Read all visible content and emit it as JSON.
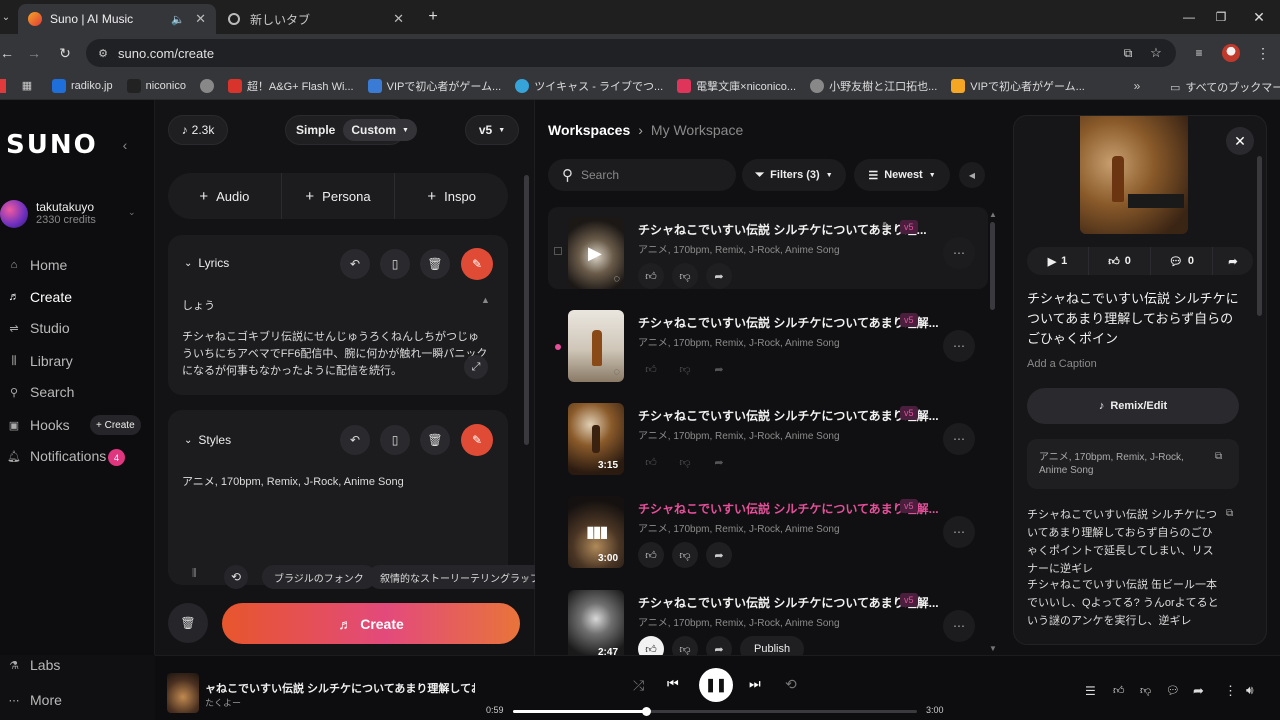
{
  "browser": {
    "tabs": [
      {
        "label": "Suno | AI Music",
        "active": true
      },
      {
        "label": "新しいタブ",
        "active": false
      }
    ],
    "url": "suno.com/create",
    "bookmarks": [
      "radiko.jp",
      "niconico",
      "超！A&G+ Flash Wi...",
      "VIPで初心者がゲーム...",
      "ツイキャス - ライブでつ...",
      "電撃文庫×niconico...",
      "小野友樹と江口拓也...",
      "VIPで初心者がゲーム..."
    ],
    "bookmark_colors": [
      "#1e6fd9",
      "#222222",
      "#888888",
      "#d9342b",
      "#3a7bd5",
      "#36a3d9",
      "#e0355a",
      "#888888",
      "#f5a623"
    ],
    "all_bookmarks": "すべてのブックマーク"
  },
  "sidebar": {
    "logo": "SUNO",
    "user": {
      "name": "takutakuyo",
      "credits": "2330 credits"
    },
    "items": [
      {
        "label": "Home",
        "icon": "home-icon"
      },
      {
        "label": "Create",
        "icon": "music-note-icon"
      },
      {
        "label": "Studio",
        "icon": "studio-icon"
      },
      {
        "label": "Library",
        "icon": "library-icon"
      },
      {
        "label": "Search",
        "icon": "search-icon"
      },
      {
        "label": "Hooks",
        "icon": "hooks-icon"
      },
      {
        "label": "Notifications",
        "icon": "bell-icon"
      }
    ],
    "hooks_create": "+ Create",
    "notification_count": "4",
    "labs": "Labs",
    "more": "More"
  },
  "create_panel": {
    "count": "2.3k",
    "mode_simple": "Simple",
    "mode_custom": "Custom",
    "version": "v5",
    "add_audio": "Audio",
    "add_persona": "Persona",
    "add_inspo": "Inspo",
    "lyrics_label": "Lyrics",
    "lyrics_first": "しょう",
    "lyrics_body": "チシャねこゴキブリ伝説にせんじゅうろくねんしちがつじゅういちにちアベマでFF6配信中、腕に何かが触れ一瞬パニックになるが何事もなかったように配信を続行。",
    "styles_label": "Styles",
    "styles_text": "アニメ, 170bpm, Remix, J-Rock, Anime Song",
    "suggestions": [
      "ブラジルのフォンク",
      "叙情的なストーリーテリングラップ"
    ],
    "create_btn": "Create"
  },
  "workspace": {
    "breadcrumb_root": "Workspaces",
    "breadcrumb_current": "My Workspace",
    "search_placeholder": "Search",
    "filters": "Filters (3)",
    "sort": "Newest",
    "songs": [
      {
        "title": "チシャねこでいすい伝説 シルチケについてあまり理...",
        "tags": "アニメ, 170bpm, Remix, J-Rock, Anime Song",
        "version": "v5",
        "duration": ""
      },
      {
        "title": "チシャねこでいすい伝説 シルチケについてあまり理解...",
        "tags": "アニメ, 170bpm, Remix, J-Rock, Anime Song",
        "version": "v5",
        "duration": ""
      },
      {
        "title": "チシャねこでいすい伝説 シルチケについてあまり理解...",
        "tags": "アニメ, 170bpm, Remix, J-Rock, Anime Song",
        "version": "v5",
        "duration": "3:15"
      },
      {
        "title": "チシャねこでいすい伝説 シルチケについてあまり理解...",
        "tags": "アニメ, 170bpm, Remix, J-Rock, Anime Song",
        "version": "v5",
        "duration": "3:00"
      },
      {
        "title": "チシャねこでいすい伝説 シルチケについてあまり理解...",
        "tags": "アニメ, 170bpm, Remix, J-Rock, Anime Song",
        "version": "v5",
        "duration": "2:47"
      }
    ],
    "publish": "Publish"
  },
  "detail": {
    "plays": "1",
    "likes": "0",
    "comments": "0",
    "title": "チシャねこでいすい伝説 シルチケについてあまり理解しておらず自らのごひゃくポイン",
    "caption": "Add a Caption",
    "remix": "Remix/Edit",
    "styles": "アニメ, 170bpm, Remix, J-Rock, Anime Song",
    "lyrics_1": "チシャねこでいすい伝説 シルチケについてあまり理解しておらず自らのごひゃくポイントで延長してしまい、リスナーに逆ギレ",
    "lyrics_2": "チシャねこでいすい伝説 缶ビール一本でいいし、Qよってる? うんorよてるという謎のアンケを実行し、逆ギレ"
  },
  "player": {
    "title": "ャねこでいすい伝説 シルチケについてあまり理解しておら",
    "artist": "たくよー",
    "current": "0:59",
    "total": "3:00",
    "progress": 0.328
  },
  "colors": {
    "accent": "#e04b35",
    "pink": "#e64f9a",
    "badge": "#e0357f"
  }
}
